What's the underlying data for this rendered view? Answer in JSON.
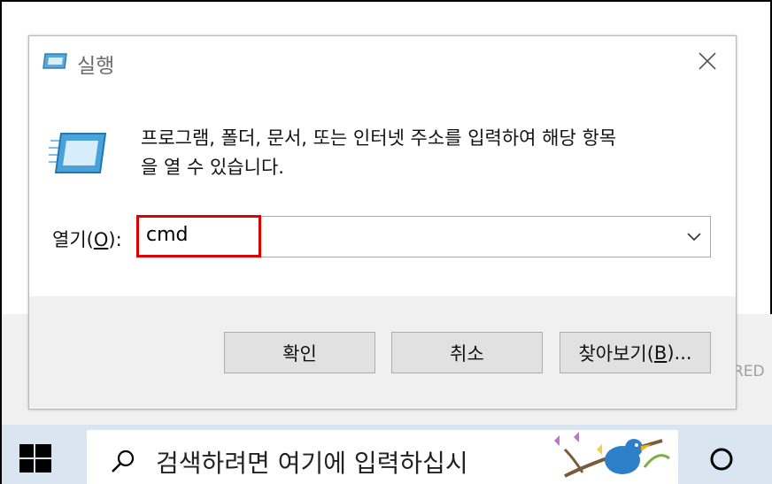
{
  "dialog": {
    "title": "실행",
    "description_line1": "프로그램, 폴더, 문서, 또는 인터넷 주소를 입력하여 해당 항목",
    "description_line2": "을 열 수 있습니다.",
    "open_label_prefix": "열기(",
    "open_label_accel": "O",
    "open_label_suffix": "):",
    "open_value": "cmd",
    "ok_label": "확인",
    "cancel_label": "취소",
    "browse_prefix": "찾아보기(",
    "browse_accel": "B",
    "browse_suffix": ")...",
    "highlight_color": "#e00000"
  },
  "background": {
    "partial_text": "RED"
  },
  "taskbar": {
    "search_placeholder": "검색하려면 여기에 입력하십시",
    "start_icon": "windows-logo-icon",
    "search_icon": "search-icon",
    "cortana_icon": "cortana-circle-icon"
  }
}
